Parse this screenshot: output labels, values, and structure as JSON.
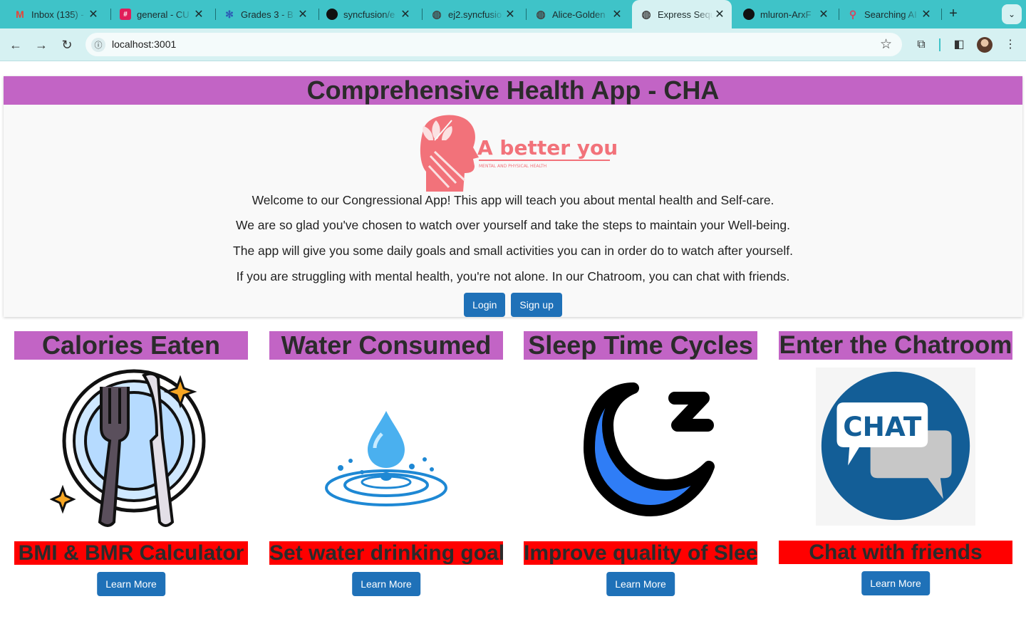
{
  "browser": {
    "tabs": [
      {
        "title": "Inbox (135) -",
        "icon": "gmail-icon",
        "color": "#ea4335",
        "glyph": "M"
      },
      {
        "title": "general - CU",
        "icon": "slack-icon",
        "color": "#e01e5a",
        "glyph": "#"
      },
      {
        "title": "Grades 3 - B",
        "icon": "canvas-icon",
        "color": "#2d5db6",
        "glyph": "✻"
      },
      {
        "title": "syncfusion/e",
        "icon": "github-icon",
        "color": "#111111",
        "glyph": "●"
      },
      {
        "title": "ej2.syncfusio",
        "icon": "globe-icon",
        "color": "#5f6368",
        "glyph": "◍"
      },
      {
        "title": "Alice-Golden",
        "icon": "globe-icon",
        "color": "#5f6368",
        "glyph": "◍"
      },
      {
        "title": "Express Sequ",
        "icon": "globe-icon",
        "color": "#5f6368",
        "glyph": "◍"
      },
      {
        "title": "mluron-ArxF",
        "icon": "github-icon",
        "color": "#111111",
        "glyph": "●"
      },
      {
        "title": "Searching AI",
        "icon": "search-ai-icon",
        "color": "#d9435f",
        "glyph": "⚲"
      }
    ],
    "active_tab": 6,
    "close_glyph": "✕",
    "new_tab_glyph": "+",
    "url": "localhost:3001"
  },
  "hero": {
    "title": "Comprehensive Health App - CHA",
    "logo_text": "A better you",
    "logo_subtext": "MENTAL AND PHYSICAL HEALTH",
    "paragraphs": [
      "Welcome to our Congressional App! This app will teach you about mental health and Self-care.",
      "We are so glad you've chosen to watch over yourself and take the steps to maintain your Well-being.",
      "The app will give you some daily goals and small activities you can in order do to watch after yourself.",
      "If you are struggling with mental health, you're not alone. In our Chatroom, you can chat with friends."
    ],
    "login_label": "Login",
    "signup_label": "Sign up"
  },
  "cards": [
    {
      "title": "Calories Eaten",
      "subtitle": "BMI & BMR Calculator",
      "button": "Learn More",
      "icon": "plate-cutlery-icon"
    },
    {
      "title": "Water Consumed",
      "subtitle": "Set water drinking goals",
      "button": "Learn More",
      "icon": "water-drop-icon"
    },
    {
      "title": "Sleep Time Cycles",
      "subtitle": "Improve quality of Sleep",
      "button": "Learn More",
      "icon": "moon-sleep-icon"
    },
    {
      "title": "Enter the Chatroom",
      "subtitle": "Chat with friends",
      "button": "Learn More",
      "icon": "chat-bubble-icon",
      "chat_text": "CHAT"
    }
  ],
  "colors": {
    "title_bar": "#c264c5",
    "subtitle_bar": "#ff0000",
    "button": "#1f71b8",
    "tabstrip": "#3fc3c8"
  }
}
